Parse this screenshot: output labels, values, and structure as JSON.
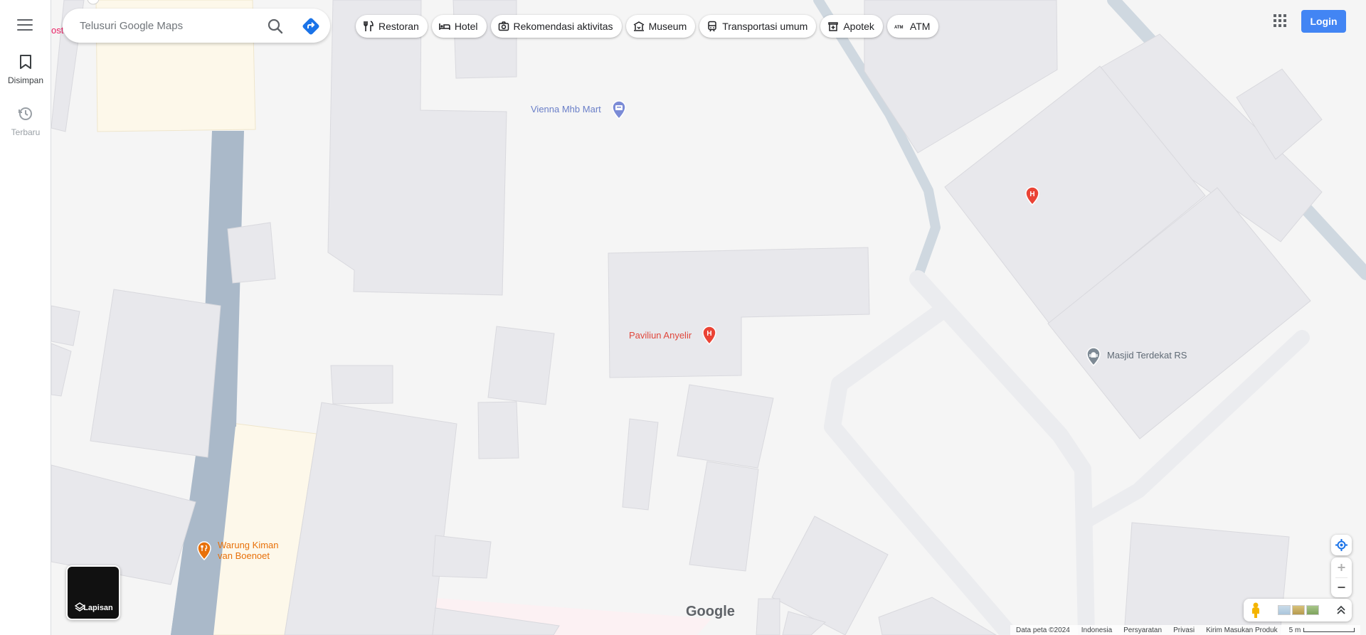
{
  "search": {
    "placeholder": "Telusuri Google Maps"
  },
  "rail": {
    "saved_label": "Disimpan",
    "recent_label": "Terbaru"
  },
  "chips": [
    {
      "label": "Restoran",
      "icon": "fork-knife-icon"
    },
    {
      "label": "Hotel",
      "icon": "bed-icon"
    },
    {
      "label": "Rekomendasi aktivitas",
      "icon": "camera-icon"
    },
    {
      "label": "Museum",
      "icon": "museum-icon"
    },
    {
      "label": "Transportasi umum",
      "icon": "train-icon"
    },
    {
      "label": "Apotek",
      "icon": "pharmacy-icon"
    },
    {
      "label": "ATM",
      "icon": "atm-icon"
    }
  ],
  "header": {
    "login_label": "Login"
  },
  "map": {
    "partial_label": "ost",
    "pois": {
      "vienna": "Vienna Mhb Mart",
      "paviliun": "Paviliun Anyelir",
      "masjid": "Masjid Terdekat RS",
      "warung_line1": "Warung Kiman",
      "warung_line2": "van Boenoet"
    },
    "hospital_marker": "H",
    "layers_label": "Lapisan",
    "google_logo": "Google"
  },
  "footer": {
    "data": "Data peta ©2024",
    "country": "Indonesia",
    "terms": "Persyaratan",
    "privacy": "Privasi",
    "feedback": "Kirim Masukan Produk",
    "scale": "5 m"
  },
  "colors": {
    "map_bg": "#f5f5f5",
    "building": "#e8e8ec",
    "water": "#aab9c9",
    "hospital_red": "#ea4335",
    "shop_blue": "#7b8bd6",
    "food_orange": "#e8710a",
    "sand": "#fdf8ea",
    "accent": "#4285f4"
  }
}
